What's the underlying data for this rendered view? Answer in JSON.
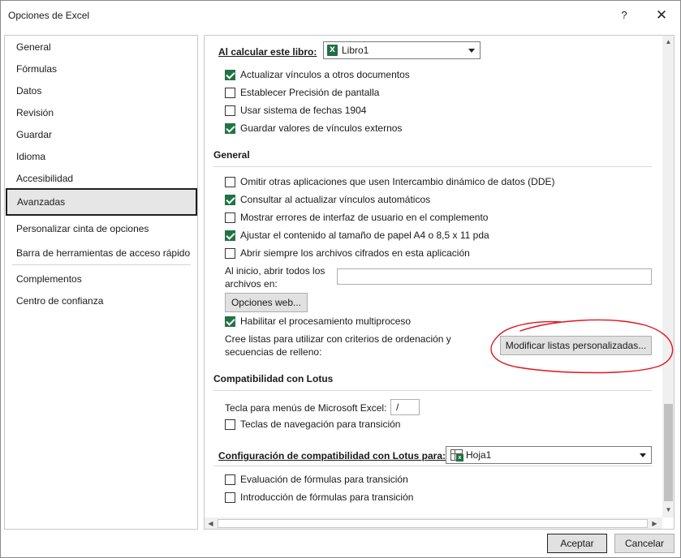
{
  "window": {
    "title": "Opciones de Excel",
    "help_label": "?",
    "close_label": "✕"
  },
  "nav": {
    "items": [
      {
        "label": "General"
      },
      {
        "label": "Fórmulas"
      },
      {
        "label": "Datos"
      },
      {
        "label": "Revisión"
      },
      {
        "label": "Guardar"
      },
      {
        "label": "Idioma"
      },
      {
        "label": "Accesibilidad"
      },
      {
        "label": "Avanzadas",
        "selected": true
      },
      {
        "label": "Personalizar cinta de opciones"
      },
      {
        "label": "Barra de herramientas de acceso rápido"
      },
      {
        "label": "Complementos"
      },
      {
        "label": "Centro de confianza"
      }
    ]
  },
  "calc_book": {
    "label": "Al calcular este libro:",
    "selected": "Libro1",
    "options": [
      {
        "label": "Actualizar vínculos a otros documentos",
        "checked": true
      },
      {
        "label": "Establecer Precisión de pantalla",
        "checked": false
      },
      {
        "label": "Usar sistema de fechas 1904",
        "checked": false
      },
      {
        "label": "Guardar valores de vínculos externos",
        "checked": true
      }
    ]
  },
  "general": {
    "title": "General",
    "options": [
      {
        "label": "Omitir otras aplicaciones que usen Intercambio dinámico de datos (DDE)",
        "checked": false
      },
      {
        "label": "Consultar al actualizar vínculos automáticos",
        "checked": true
      },
      {
        "label": "Mostrar errores de interfaz de usuario en el complemento",
        "checked": false
      },
      {
        "label": "Ajustar el contenido al tamaño de papel A4 o 8,5 x 11 pda",
        "checked": true
      },
      {
        "label": "Abrir siempre los archivos cifrados en esta aplicación",
        "checked": false
      }
    ],
    "startup_label_1": "Al inicio, abrir todos los",
    "startup_label_2": "archivos en:",
    "startup_value": "",
    "web_options_button": "Opciones web...",
    "multiprocess": {
      "label": "Habilitar el procesamiento multiproceso",
      "checked": true
    },
    "lists_label_1": "Cree listas para utilizar con criterios de ordenación y",
    "lists_label_2": "secuencias de relleno:",
    "edit_lists_button": "Modificar listas personalizadas..."
  },
  "lotus": {
    "title": "Compatibilidad con Lotus",
    "menu_key_label": "Tecla para menús de Microsoft Excel:",
    "menu_key_value": "/",
    "nav_keys": {
      "label": "Teclas de navegación para transición",
      "checked": false
    }
  },
  "lotus_settings": {
    "label": "Configuración de compatibilidad con Lotus para:",
    "selected": "Hoja1",
    "options": [
      {
        "label": "Evaluación de fórmulas para transición",
        "checked": false
      },
      {
        "label": "Introducción de fórmulas para transición",
        "checked": false
      }
    ]
  },
  "footer": {
    "ok_label": "Aceptar",
    "cancel_label": "Cancelar"
  },
  "colors": {
    "check_green": "#217346",
    "annotation_red": "#e0141e"
  }
}
